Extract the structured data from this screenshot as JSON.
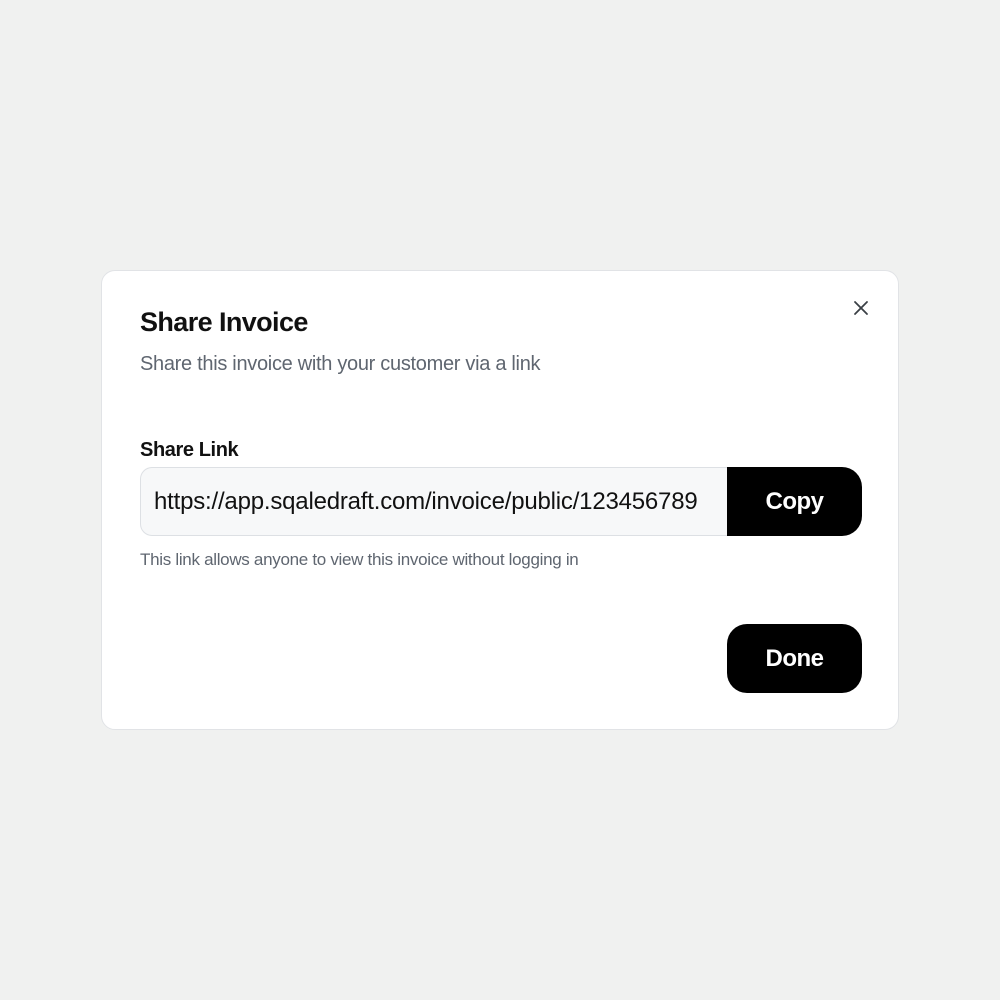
{
  "dialog": {
    "title": "Share Invoice",
    "subtitle": "Share this invoice with your customer via a link",
    "close_icon": "close-icon",
    "share_link": {
      "label": "Share Link",
      "value": "https://app.sqaledraft.com/invoice/public/123456789",
      "copy_label": "Copy",
      "helper_text": "This link allows anyone to view this invoice without logging in"
    },
    "done_label": "Done"
  },
  "colors": {
    "page_background": "#f0f1f0",
    "dialog_background": "#ffffff",
    "primary_button": "#000000",
    "primary_button_text": "#ffffff",
    "heading_text": "#111111",
    "muted_text": "#5f6670",
    "input_background": "#f7f8f9"
  }
}
